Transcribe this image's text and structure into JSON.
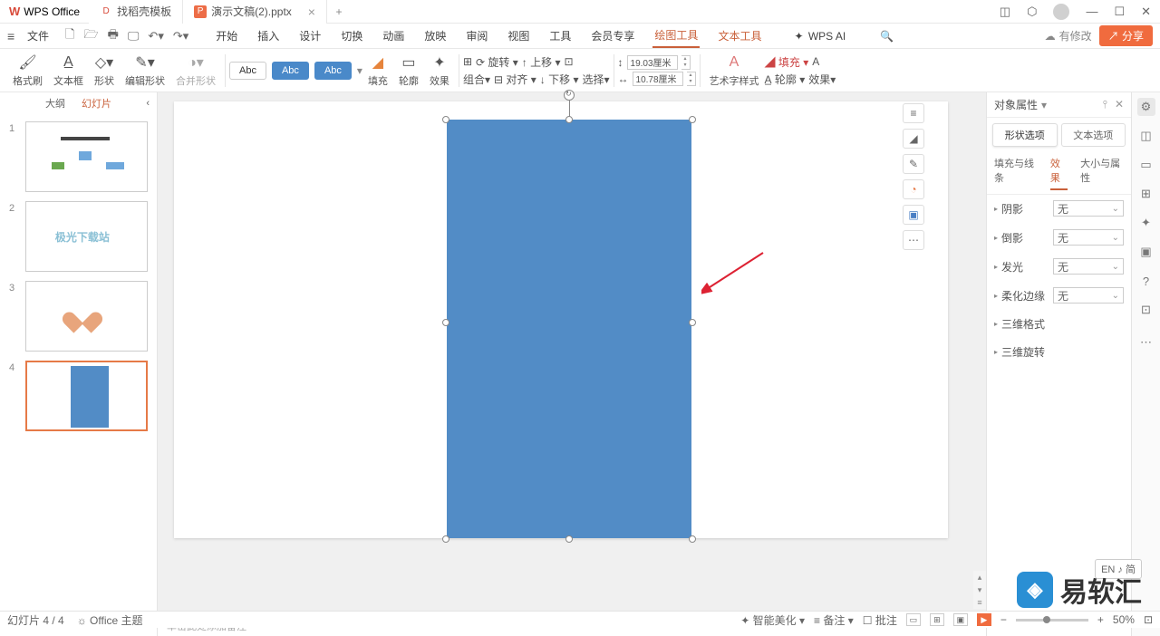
{
  "title": {
    "app": "WPS Office",
    "tab1": "找稻壳模板",
    "tab2": "演示文稿(2).pptx",
    "newChar": "+"
  },
  "menu": {
    "file": "文件",
    "tabs": [
      "开始",
      "插入",
      "设计",
      "切换",
      "动画",
      "放映",
      "审阅",
      "视图",
      "工具",
      "会员专享",
      "绘图工具",
      "文本工具"
    ],
    "ai": "WPS AI",
    "cloud": "有修改",
    "share": "分享"
  },
  "ribbon": {
    "g1": "格式刷",
    "g2": "文本框",
    "g3": "形状",
    "g4": "编辑形状",
    "g5": "合并形状",
    "abc": "Abc",
    "fill": "填充",
    "outline": "轮廓",
    "effect": "效果",
    "group": "组合",
    "rotate": "旋转",
    "align": "对齐",
    "up": "上移",
    "down": "下移",
    "select": "选择",
    "w": "19.03厘米",
    "h": "10.78厘米",
    "art": "艺术字样式",
    "fill2": "填充",
    "outline2": "轮廓",
    "effect2": "效果"
  },
  "left": {
    "outline": "大纲",
    "slides": "幻灯片",
    "th2txt": "极光下载站"
  },
  "notes": "单击此处添加备注",
  "prop": {
    "title": "对象属性",
    "t1": "形状选项",
    "t2": "文本选项",
    "st1": "填充与线条",
    "st2": "效果",
    "st3": "大小与属性",
    "shadow": "阴影",
    "reflection": "倒影",
    "glow": "发光",
    "soft": "柔化边缘",
    "d3fmt": "三维格式",
    "d3rot": "三维旋转",
    "none": "无"
  },
  "status": {
    "page": "幻灯片 4 / 4",
    "theme": "Office 主题",
    "beautify": "智能美化",
    "note": "备注",
    "comment": "批注",
    "zoom": "50%",
    "lang": "EN ♪ 简"
  },
  "watermark": "易软汇"
}
